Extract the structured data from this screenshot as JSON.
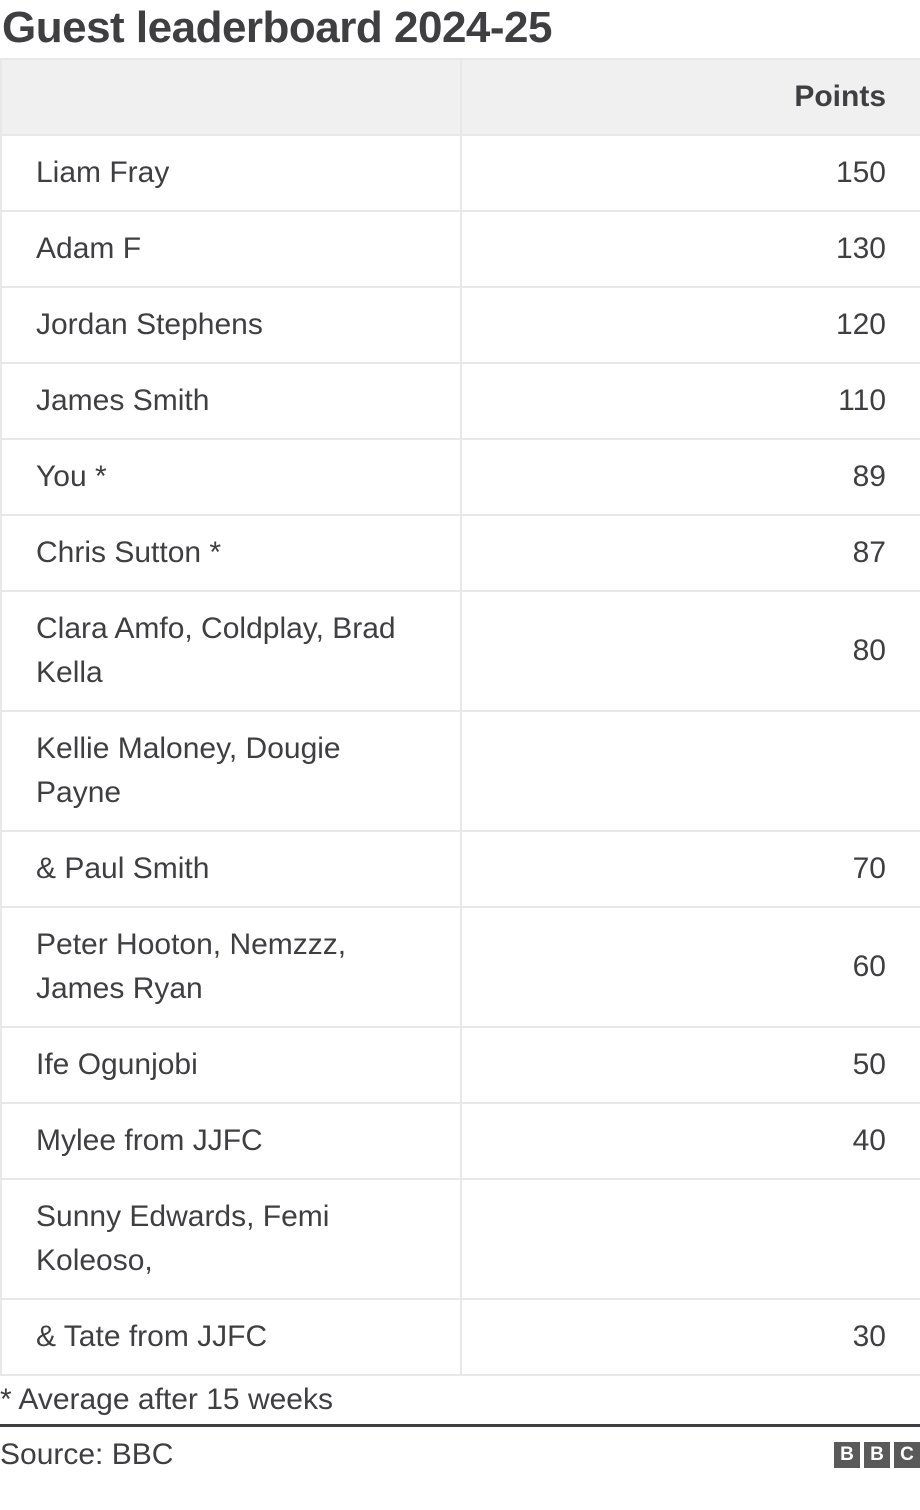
{
  "chart_data": {
    "type": "table",
    "title": "Guest leaderboard 2024-25",
    "columns": [
      "",
      "Points"
    ],
    "rows": [
      {
        "name": "Liam Fray",
        "points": "150"
      },
      {
        "name": "Adam F",
        "points": "130"
      },
      {
        "name": "Jordan Stephens",
        "points": "120"
      },
      {
        "name": "James Smith",
        "points": "110"
      },
      {
        "name": "You *",
        "points": "89"
      },
      {
        "name": "Chris Sutton *",
        "points": "87"
      },
      {
        "name": "Clara Amfo, Coldplay, Brad Kella",
        "points": "80"
      },
      {
        "name": "Kellie Maloney, Dougie Payne",
        "points": ""
      },
      {
        "name": "& Paul Smith",
        "points": "70"
      },
      {
        "name": "Peter Hooton, Nemzzz, James Ryan",
        "points": "60"
      },
      {
        "name": "Ife Ogunjobi",
        "points": "50"
      },
      {
        "name": "Mylee from JJFC",
        "points": "40"
      },
      {
        "name": "Sunny Edwards, Femi Koleoso,",
        "points": ""
      },
      {
        "name": "& Tate from JJFC",
        "points": "30"
      }
    ],
    "note": "* Average after 15 weeks",
    "source": "Source: BBC"
  },
  "logo": [
    "B",
    "B",
    "C"
  ],
  "logo_icon": "bbc-logo-icon"
}
